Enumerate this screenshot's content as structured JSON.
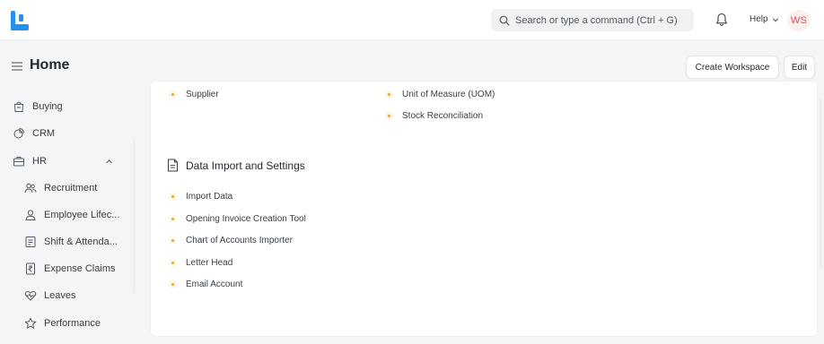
{
  "navbar": {
    "search_placeholder": "Search or type a command (Ctrl + G)",
    "help_label": "Help",
    "avatar_initials": "WS",
    "brand_color": "#2490ef",
    "avatar_color": "#e24c4c"
  },
  "page": {
    "title": "Home",
    "create_workspace_label": "Create Workspace",
    "edit_label": "Edit"
  },
  "sidebar": {
    "items": [
      {
        "label": "Buying",
        "icon": "shopping-bag-icon"
      },
      {
        "label": "CRM",
        "icon": "crm-chart-icon"
      },
      {
        "label": "HR",
        "icon": "briefcase-icon",
        "expanded": true
      },
      {
        "label": "Recruitment",
        "icon": "users-icon"
      },
      {
        "label": "Employee Lifec...",
        "icon": "user-icon"
      },
      {
        "label": "Shift & Attenda...",
        "icon": "checklist-icon"
      },
      {
        "label": "Expense Claims",
        "icon": "rupee-receipt-icon"
      },
      {
        "label": "Leaves",
        "icon": "heartbeat-icon"
      },
      {
        "label": "Performance",
        "icon": "star-icon"
      }
    ]
  },
  "main": {
    "top_links": {
      "left": [
        "Supplier"
      ],
      "right": [
        "Unit of Measure (UOM)",
        "Stock Reconciliation"
      ]
    },
    "section": {
      "title": "Data Import and Settings",
      "links": [
        "Import Data",
        "Opening Invoice Creation Tool",
        "Chart of Accounts Importer",
        "Letter Head",
        "Email Account"
      ]
    }
  }
}
